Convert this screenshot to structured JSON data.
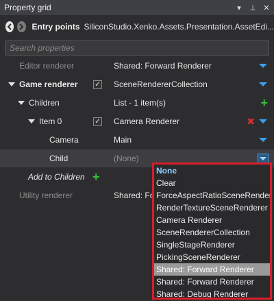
{
  "panel": {
    "title": "Property grid",
    "pin_glyph": "▾",
    "pushpin_glyph": "⊥",
    "close_glyph": "✕"
  },
  "nav": {
    "label": "Entry points",
    "path": "SiliconStudio.Xenko.Assets.Presentation.AssetEdi..."
  },
  "search": {
    "placeholder": "Search properties",
    "value": ""
  },
  "rows": {
    "editor_renderer": {
      "name": "Editor renderer",
      "value": "Shared: Forward Renderer"
    },
    "game_renderer": {
      "name": "Game renderer",
      "value": "SceneRendererCollection",
      "checked": true
    },
    "children": {
      "name": "Children",
      "value": "List - 1 item(s)"
    },
    "item0": {
      "name": "Item 0",
      "value": "Camera Renderer",
      "checked": true
    },
    "camera": {
      "name": "Camera",
      "value": "Main"
    },
    "child": {
      "name": "Child",
      "value": "(None)"
    },
    "add_children": {
      "name": "Add to Children"
    },
    "utility_renderer": {
      "name": "Utility renderer",
      "value": "Shared: Fo"
    }
  },
  "dropdown": {
    "options": [
      "None",
      "Clear",
      "ForceAspectRatioSceneRenderer",
      "RenderTextureSceneRenderer",
      "Camera Renderer",
      "SceneRendererCollection",
      "SingleStageRenderer",
      "PickingSceneRenderer",
      "Shared: Forward Renderer",
      "Shared: Forward Renderer",
      "Shared: Debug Renderer"
    ],
    "selected_index": 8
  },
  "colors": {
    "accent": "#3aa0f0",
    "add": "#35c23a",
    "remove": "#d0302f",
    "highlight_border": "#d81e2a"
  }
}
